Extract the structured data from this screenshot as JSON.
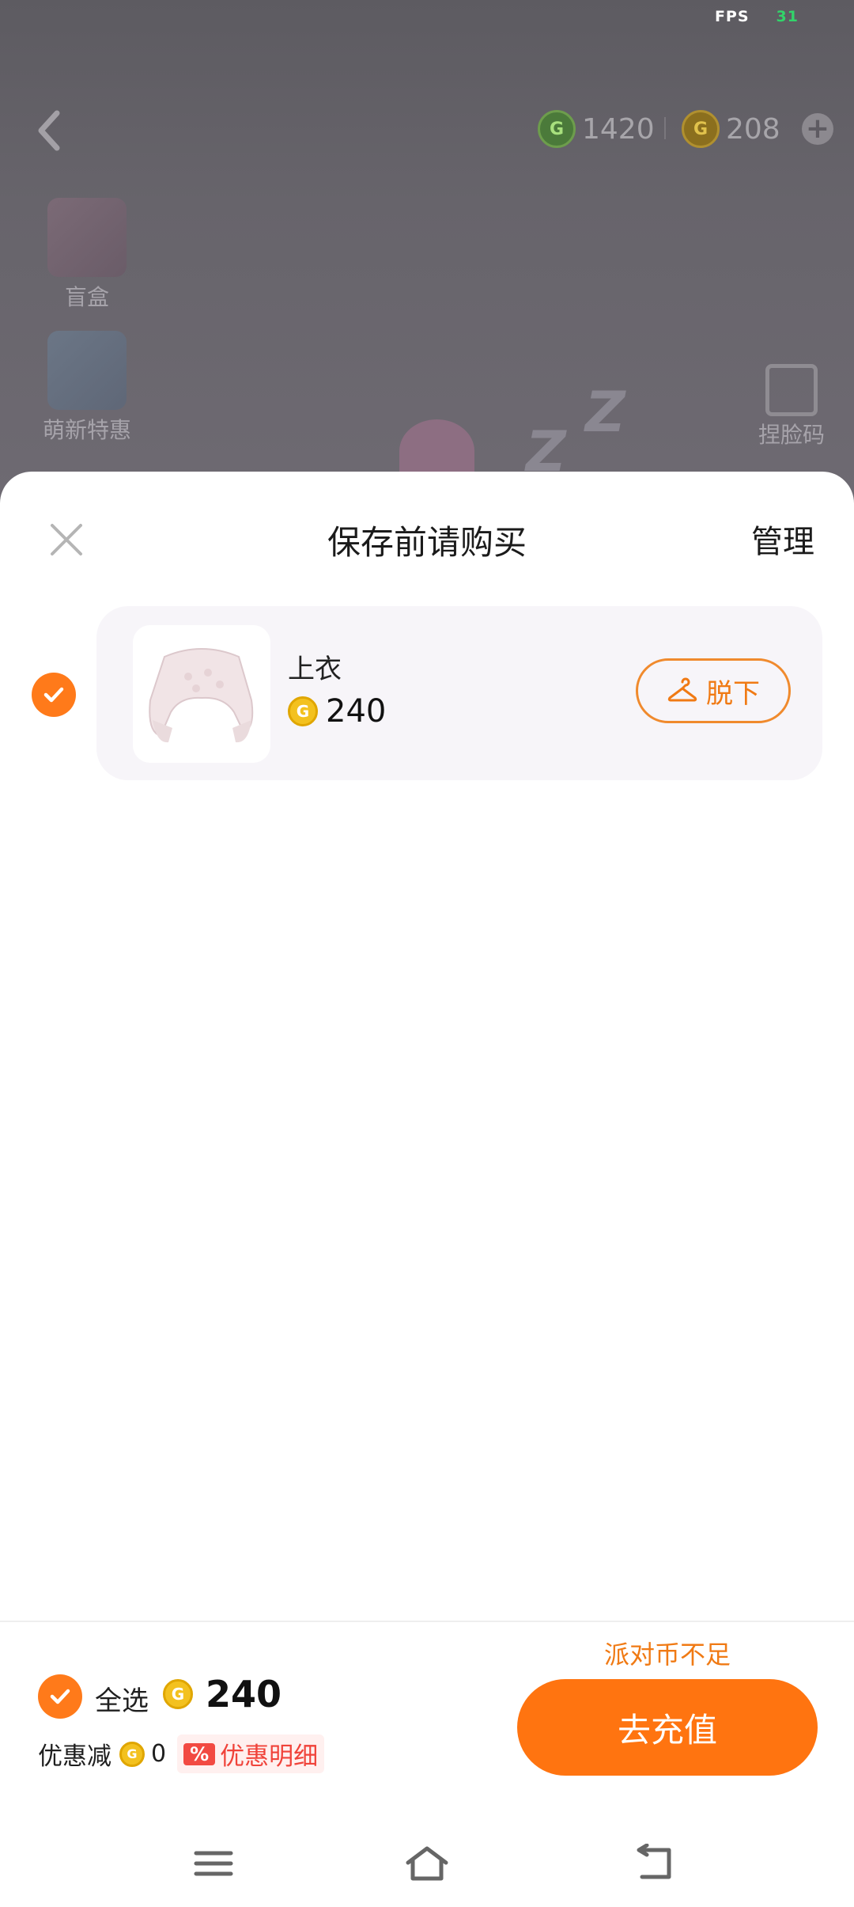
{
  "status": {
    "fps_label": "FPS",
    "fps_value": "31"
  },
  "top_bar": {
    "green_coin_amount": "1420",
    "gold_coin_amount": "208"
  },
  "side_menu": [
    {
      "label": "盲盒",
      "icon": "gift-box-icon"
    },
    {
      "label": "萌新特惠",
      "icon": "newbie-deal-icon"
    }
  ],
  "right_menu": {
    "face_pinch_label": "捏脸码"
  },
  "sheet": {
    "title": "保存前请购买",
    "manage_label": "管理",
    "items": [
      {
        "name": "上衣",
        "price": "240",
        "action_label": "脱下",
        "checked": true
      }
    ]
  },
  "footer": {
    "select_all_label": "全选",
    "total_price": "240",
    "discount_label": "优惠减",
    "discount_value": "0",
    "discount_tag": "%",
    "discount_detail_label": "优惠明细",
    "insufficient_label": "派对币不足",
    "recharge_label": "去充值"
  },
  "colors": {
    "accent": "#ff7410",
    "gold": "#f3c11f",
    "fps_green": "#32d36a"
  }
}
